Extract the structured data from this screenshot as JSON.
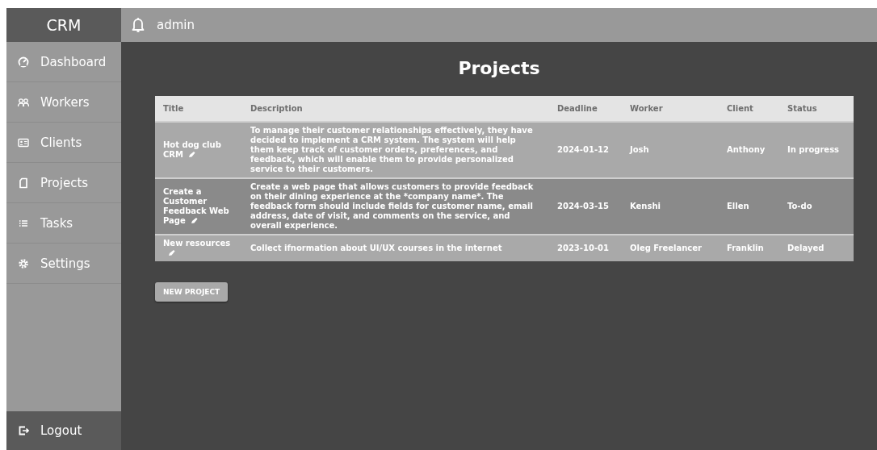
{
  "sidebar": {
    "brand": "CRM",
    "items": [
      {
        "label": "Dashboard"
      },
      {
        "label": "Workers"
      },
      {
        "label": "Clients"
      },
      {
        "label": "Projects"
      },
      {
        "label": "Tasks"
      },
      {
        "label": "Settings"
      }
    ],
    "logout": "Logout"
  },
  "topbar": {
    "user": "admin"
  },
  "page_title": "Projects",
  "table": {
    "columns": [
      "Title",
      "Description",
      "Deadline",
      "Worker",
      "Client",
      "Status"
    ],
    "rows": [
      {
        "selected": false,
        "cells": [
          "Hot dog club CRM",
          "To manage their customer relationships effectively, they have decided to implement a CRM system. The system will help them keep track of customer orders, preferences, and feedback, which will enable them to provide personalized service to their customers.",
          "2024-01-12",
          "Josh",
          "Anthony",
          "In progress"
        ]
      },
      {
        "selected": true,
        "cells": [
          "Create a Customer Feedback Web Page",
          "Create a web page that allows customers to provide feedback on their dining experience at the *company name*. The feedback form should include fields for customer name, email address, date of visit, and comments on the service, and overall experience.",
          "2024-03-15",
          "Kenshi",
          "Ellen",
          "To-do"
        ]
      },
      {
        "selected": false,
        "cells": [
          "New resources",
          "Collect ifnormation about UI/UX courses in the internet",
          "2023-10-01",
          "Oleg Freelancer",
          "Franklin",
          "Delayed"
        ]
      }
    ]
  },
  "new_button": "NEW PROJECT"
}
